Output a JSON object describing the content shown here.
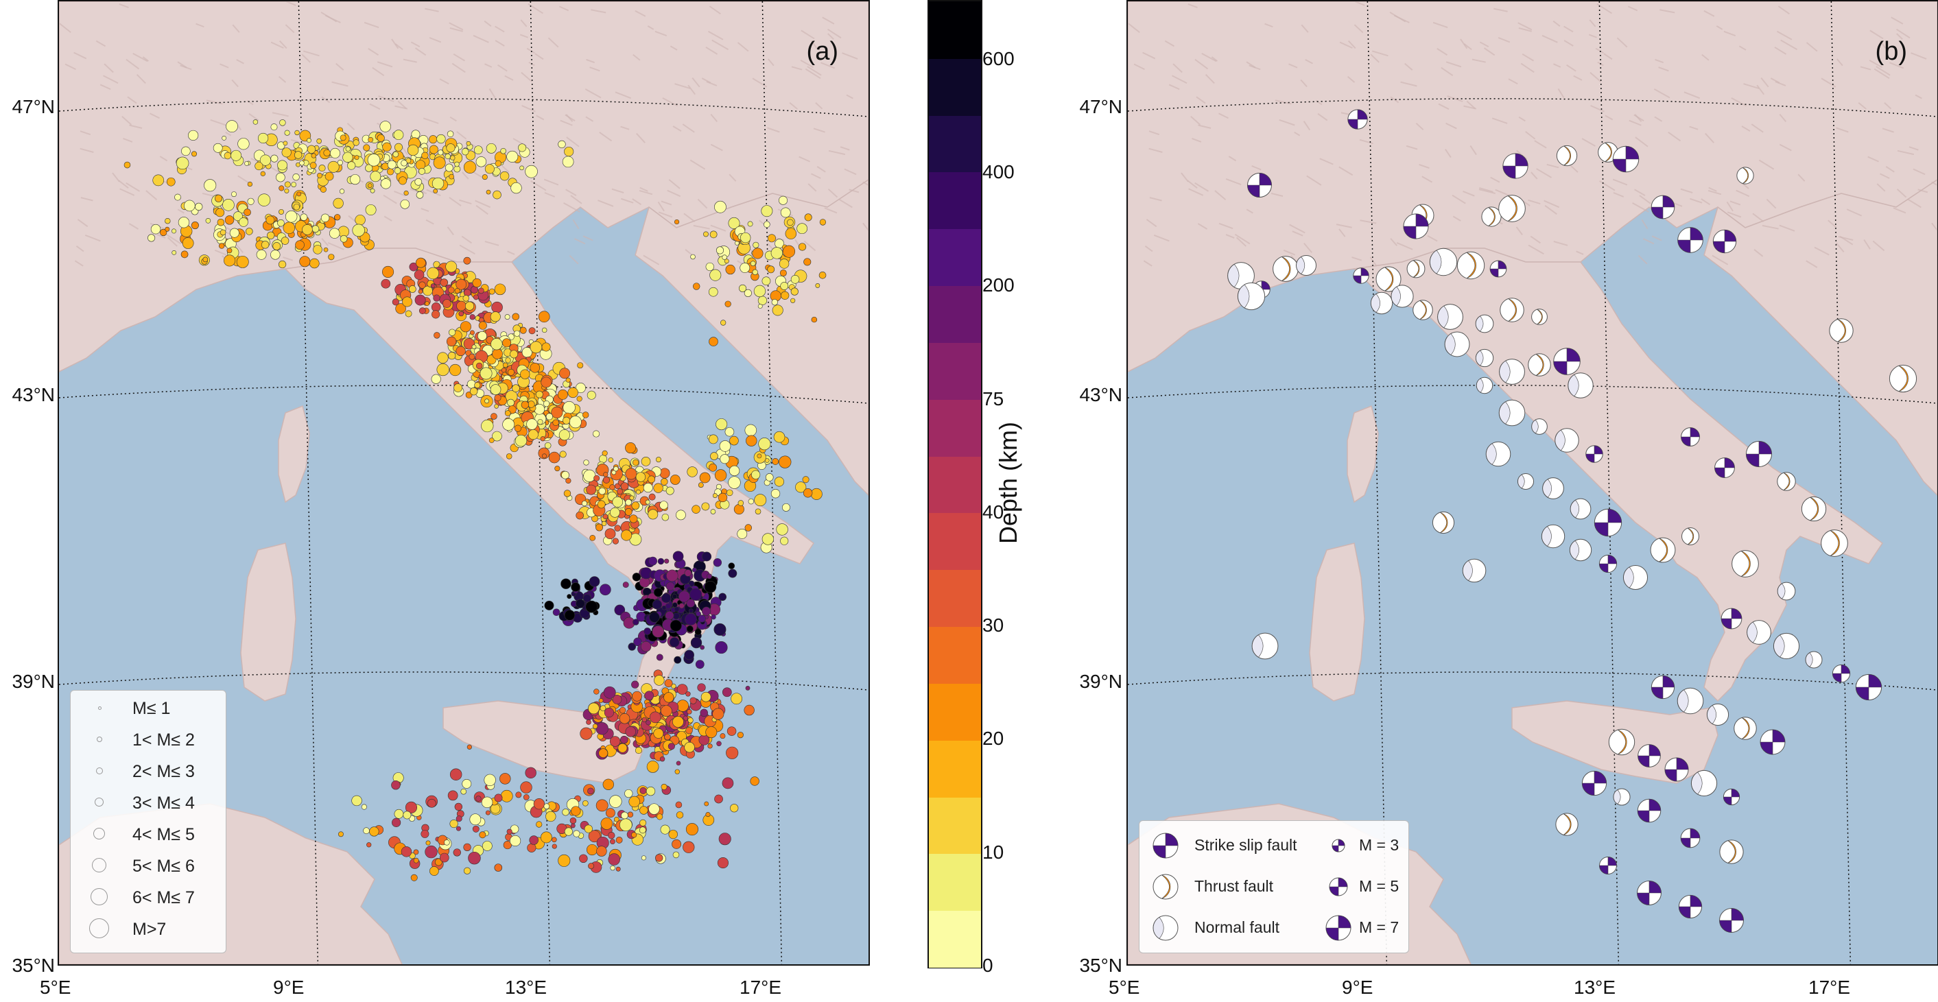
{
  "panel_a": {
    "letter": "(a)"
  },
  "panel_b": {
    "letter": "(b)"
  },
  "axes": {
    "x_ticks": [
      "5°E",
      "9°E",
      "13°E",
      "17°E"
    ],
    "y_ticks": [
      "47°N",
      "43°N",
      "39°N",
      "35°N"
    ]
  },
  "colorbar": {
    "label": "Depth (km)",
    "ticks": [
      "0",
      "10",
      "20",
      "30",
      "40",
      "75",
      "200",
      "400",
      "600"
    ],
    "colors": [
      "#fbfca4",
      "#f1ef75",
      "#f8d13a",
      "#fcb014",
      "#f98e09",
      "#f06f1f",
      "#e35933",
      "#cf4446",
      "#b83655",
      "#9f2a63",
      "#87216b",
      "#6a176e",
      "#51127c",
      "#380962",
      "#1f0c48",
      "#0d0829",
      "#000004"
    ]
  },
  "legend_a": {
    "entries": [
      "M≤ 1",
      "1< M≤ 2",
      "2< M≤ 3",
      "3< M≤ 4",
      "4< M≤ 5",
      "5< M≤ 6",
      "6< M≤ 7",
      "M>7"
    ]
  },
  "legend_b": {
    "fault_types": [
      "Strike slip fault",
      "Thrust fault",
      "Normal fault"
    ],
    "magnitudes": [
      "M = 3",
      "M = 5",
      "M = 7"
    ],
    "colors": {
      "strike_slip": "#4a1486",
      "thrust": "#f28c0f",
      "normal": "#e8e8f4"
    }
  },
  "map_colors": {
    "sea": "#a9c3d9",
    "land": "#e4d2d0",
    "relief": "#cdb5b3"
  },
  "map_features": {
    "region": "Italy and surroundings",
    "extent_lon": [
      5,
      19
    ],
    "extent_lat": [
      35,
      48
    ]
  }
}
